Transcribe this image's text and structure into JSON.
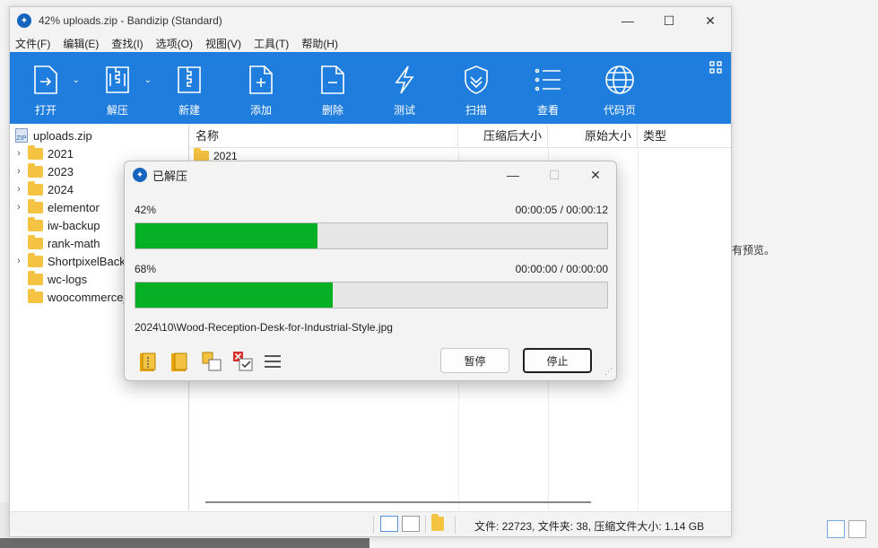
{
  "background": {
    "preview_text": "有预览。"
  },
  "window": {
    "title": "42% uploads.zip - Bandizip (Standard)",
    "minimize_glyph": "—",
    "maximize_glyph": "☐",
    "close_glyph": "✕"
  },
  "menu": [
    "文件(F)",
    "编辑(E)",
    "查找(I)",
    "选项(O)",
    "视图(V)",
    "工具(T)",
    "帮助(H)"
  ],
  "toolbar": {
    "open": "打开",
    "extract": "解压",
    "new": "新建",
    "add": "添加",
    "delete": "删除",
    "test": "测试",
    "scan": "扫描",
    "view": "查看",
    "codepage": "代码页",
    "dropdown_glyph": "⌄"
  },
  "tree": {
    "root": "uploads.zip",
    "items": [
      "2021",
      "2023",
      "2024",
      "elementor",
      "iw-backup",
      "rank-math",
      "ShortpixelBackups",
      "wc-logs",
      "woocommerce_uploads"
    ]
  },
  "list": {
    "columns": [
      "名称",
      "压缩后大小",
      "原始大小",
      "类型"
    ],
    "rows": [
      "2021"
    ]
  },
  "status": {
    "text": "文件: 22723, 文件夹: 38, 压缩文件大小: 1.14 GB"
  },
  "dialog": {
    "title": "已解压",
    "progress": [
      {
        "percent_label": "42%",
        "time": "00:00:05 / 00:00:12",
        "fraction": 0.385
      },
      {
        "percent_label": "68%",
        "time": "00:00:00 / 00:00:00",
        "fraction": 0.418
      }
    ],
    "current_file": "2024\\10\\Wood-Reception-Desk-for-Industrial-Style.jpg",
    "pause_label": "暂停",
    "stop_label": "停止"
  }
}
